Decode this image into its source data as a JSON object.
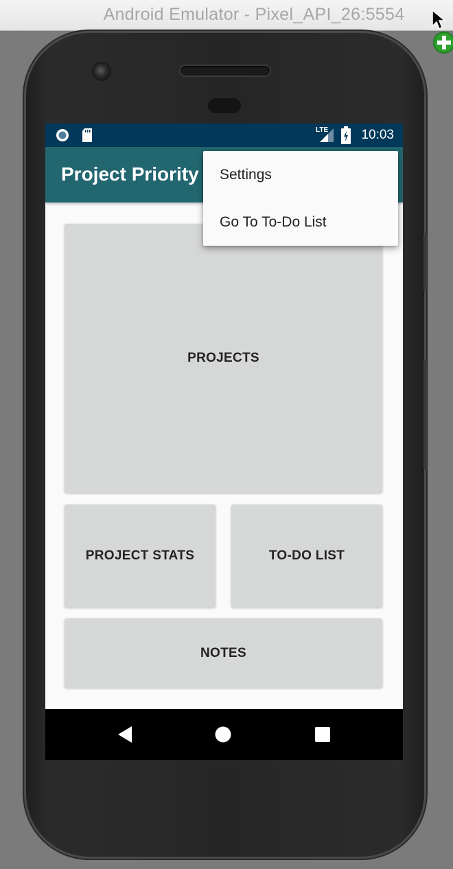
{
  "window": {
    "title": "Android Emulator - Pixel_API_26:5554"
  },
  "status_bar": {
    "time": "10:03",
    "network": "LTE"
  },
  "app_bar": {
    "title": "Project Priority"
  },
  "overflow_menu": {
    "items": [
      "Settings",
      "Go To To-Do List"
    ]
  },
  "tiles": {
    "projects": "PROJECTS",
    "project_stats": "PROJECT STATS",
    "todo_list": "TO-DO LIST",
    "notes": "NOTES"
  },
  "colors": {
    "status_bar": "#02395a",
    "app_bar": "#226670",
    "tile": "#d6d7d7",
    "screen_bg": "#fafafa"
  }
}
